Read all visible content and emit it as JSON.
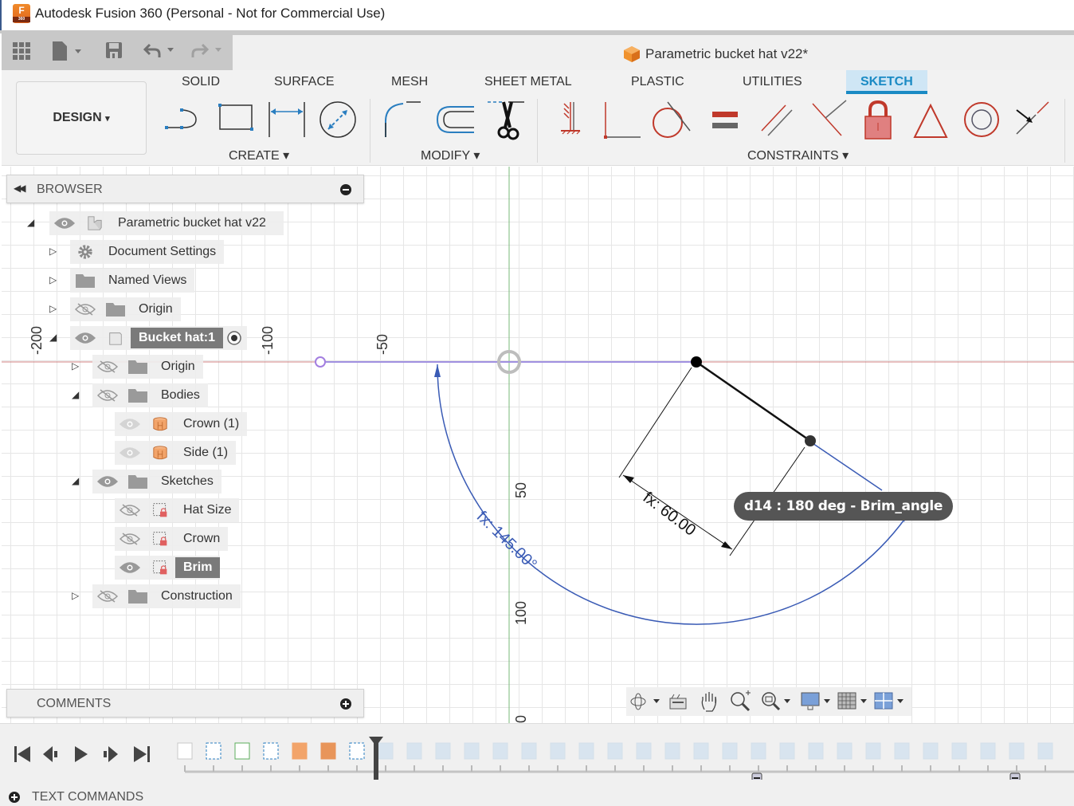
{
  "window": {
    "title": "Autodesk Fusion 360 (Personal - Not for Commercial Use)",
    "app_icon": "fusion-360-logo",
    "app_icon_letter": "F",
    "app_icon_sub": "360"
  },
  "quick_access": {
    "icons": [
      "grid-menu-icon",
      "file-icon",
      "save-icon",
      "undo-icon",
      "redo-icon"
    ]
  },
  "document": {
    "title": "Parametric bucket hat v22*"
  },
  "workspace": {
    "label": "DESIGN",
    "dropdown_glyph": "▾"
  },
  "tabs": [
    {
      "label": "SOLID",
      "active": false
    },
    {
      "label": "SURFACE",
      "active": false
    },
    {
      "label": "MESH",
      "active": false
    },
    {
      "label": "SHEET METAL",
      "active": false
    },
    {
      "label": "PLASTIC",
      "active": false
    },
    {
      "label": "UTILITIES",
      "active": false
    },
    {
      "label": "SKETCH",
      "active": true
    }
  ],
  "groups": {
    "create": {
      "label": "CREATE ▾",
      "tools": [
        "line-icon",
        "rectangle-icon",
        "dimension-icon",
        "circle-diameter-icon"
      ]
    },
    "modify": {
      "label": "MODIFY ▾",
      "tools": [
        "fillet-icon",
        "offset-icon",
        "trim-icon"
      ]
    },
    "constraints": {
      "label": "CONSTRAINTS ▾",
      "tools": [
        "fix-constraint-icon",
        "coincident-icon",
        "tangent-icon",
        "equal-icon",
        "parallel-icon",
        "perpendicular-icon",
        "lock-icon",
        "triangle-icon",
        "concentric-icon",
        "midpoint-icon"
      ]
    }
  },
  "colors": {
    "accent": "#1a8ac4",
    "sketch_tab_bg": "#cfe6f5",
    "constraint_red": "#c0392b",
    "sketch_blue": "#3a5bb5",
    "x_axis": "#c05050",
    "y_axis": "#6aaa6a",
    "tooltip_bg": "#555555"
  },
  "browser": {
    "title": "BROWSER",
    "nodes": [
      {
        "label": "Parametric bucket hat v22",
        "expander": "expanded",
        "eye": "visible",
        "icon": "component-icon"
      },
      {
        "label": "Document Settings",
        "expander": "collapsed",
        "icon": "gear-icon"
      },
      {
        "label": "Named Views",
        "expander": "collapsed",
        "icon": "folder-icon"
      },
      {
        "label": "Origin",
        "expander": "collapsed",
        "eye": "hidden",
        "icon": "folder-icon"
      },
      {
        "label": "Bucket hat:1",
        "expander": "expanded",
        "eye": "visible",
        "icon": "body-component-icon",
        "selected": true,
        "active_radio": true
      },
      {
        "label": "Origin",
        "expander": "collapsed",
        "eye": "hidden",
        "icon": "folder-icon"
      },
      {
        "label": "Bodies",
        "expander": "expanded",
        "eye": "hidden",
        "icon": "folder-icon"
      },
      {
        "label": "Crown (1)",
        "eye": "faded",
        "icon": "body-icon"
      },
      {
        "label": "Side (1)",
        "eye": "faded",
        "icon": "body-icon"
      },
      {
        "label": "Sketches",
        "expander": "expanded",
        "eye": "visible",
        "icon": "folder-icon"
      },
      {
        "label": "Hat Size",
        "eye": "hidden",
        "icon": "locked-sketch-icon"
      },
      {
        "label": "Crown",
        "eye": "hidden",
        "icon": "locked-sketch-icon"
      },
      {
        "label": "Brim",
        "eye": "visible",
        "icon": "locked-sketch-icon",
        "selected": true
      },
      {
        "label": "Construction",
        "expander": "collapsed",
        "eye": "hidden",
        "icon": "folder-icon"
      }
    ]
  },
  "canvas": {
    "axis_labels": [
      "-200",
      "-100",
      "-50",
      "50",
      "100",
      "0"
    ],
    "dimensions": {
      "linear": "fx: 60.00",
      "angular": "fx: 145.00°"
    },
    "tooltip": "d14 : 180 deg - Brim_angle"
  },
  "comments": {
    "title": "COMMENTS"
  },
  "navigation_bar": {
    "icons": [
      "orbit-icon",
      "look-at-icon",
      "pan-icon",
      "zoom-icon",
      "zoom-window-icon",
      "display-settings-icon",
      "grid-settings-icon",
      "viewports-icon"
    ]
  },
  "timeline": {
    "controls": [
      "go-to-start-icon",
      "step-back-icon",
      "play-icon",
      "step-forward-icon",
      "go-to-end-icon"
    ],
    "active_features": 7,
    "total_features_visible": 31
  },
  "text_commands": {
    "title": "TEXT COMMANDS"
  }
}
